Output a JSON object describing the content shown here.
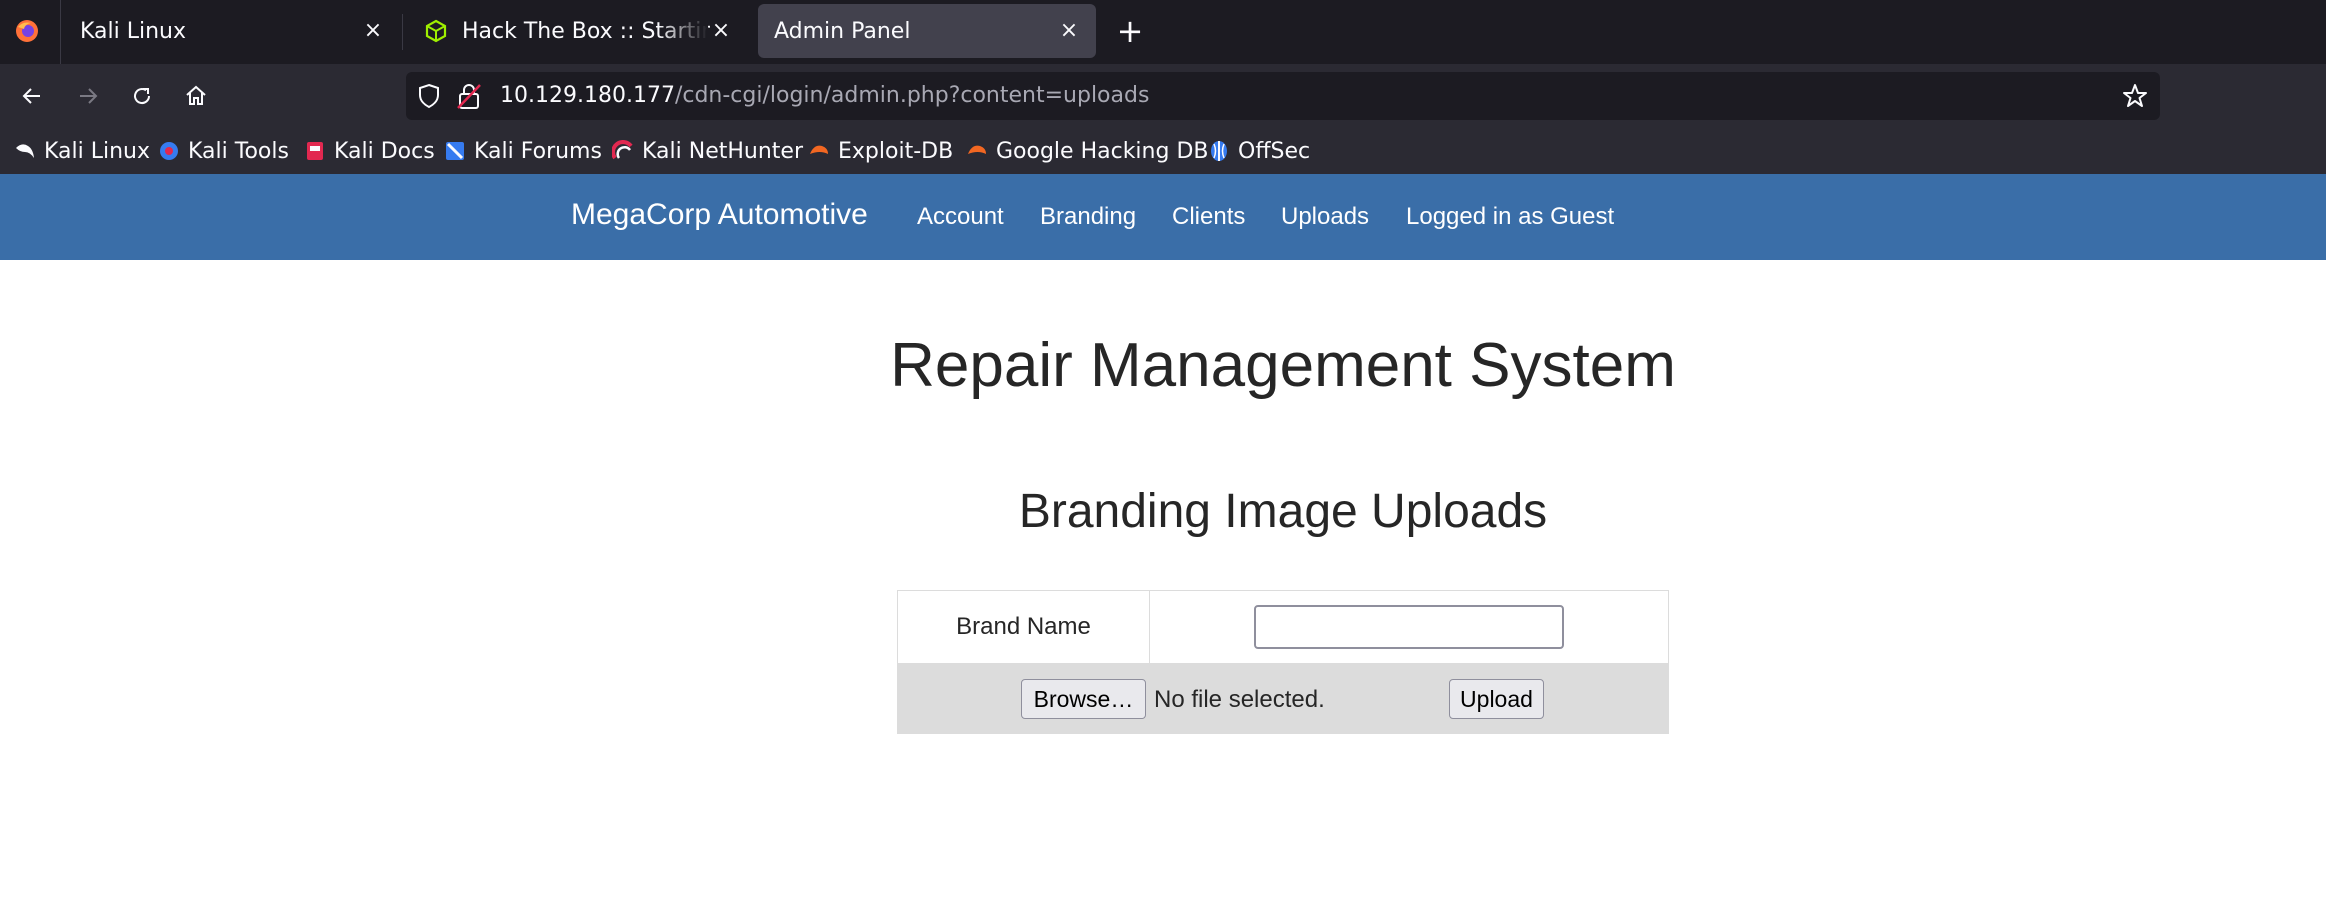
{
  "browser": {
    "tabs": [
      {
        "title": "Kali Linux"
      },
      {
        "title": "Hack The Box :: Starting Point"
      },
      {
        "title": "Admin Panel"
      }
    ],
    "close_glyph": "×",
    "new_tab_glyph": "+",
    "url_host": "10.129.180.177",
    "url_path": "/cdn-cgi/login/admin.php?content=uploads",
    "bookmarks": [
      {
        "label": "Kali Linux",
        "icon": "kali-dragon-icon"
      },
      {
        "label": "Kali Tools",
        "icon": "kali-tools-icon"
      },
      {
        "label": "Kali Docs",
        "icon": "kali-docs-icon"
      },
      {
        "label": "Kali Forums",
        "icon": "kali-forums-icon"
      },
      {
        "label": "Kali NetHunter",
        "icon": "kali-nethunter-icon"
      },
      {
        "label": "Exploit-DB",
        "icon": "exploit-db-icon"
      },
      {
        "label": "Google Hacking DB",
        "icon": "ghdb-icon"
      },
      {
        "label": "OffSec",
        "icon": "offsec-icon"
      }
    ]
  },
  "site": {
    "brand": "MegaCorp Automotive",
    "nav": [
      "Account",
      "Branding",
      "Clients",
      "Uploads",
      "Logged in as Guest"
    ],
    "nav_color": "#3a6ea8",
    "title": "Repair Management System",
    "section_title": "Branding Image Uploads",
    "form": {
      "brand_label": "Brand Name",
      "brand_value": "",
      "browse_label": "Browse…",
      "file_status": "No file selected.",
      "upload_label": "Upload"
    }
  }
}
